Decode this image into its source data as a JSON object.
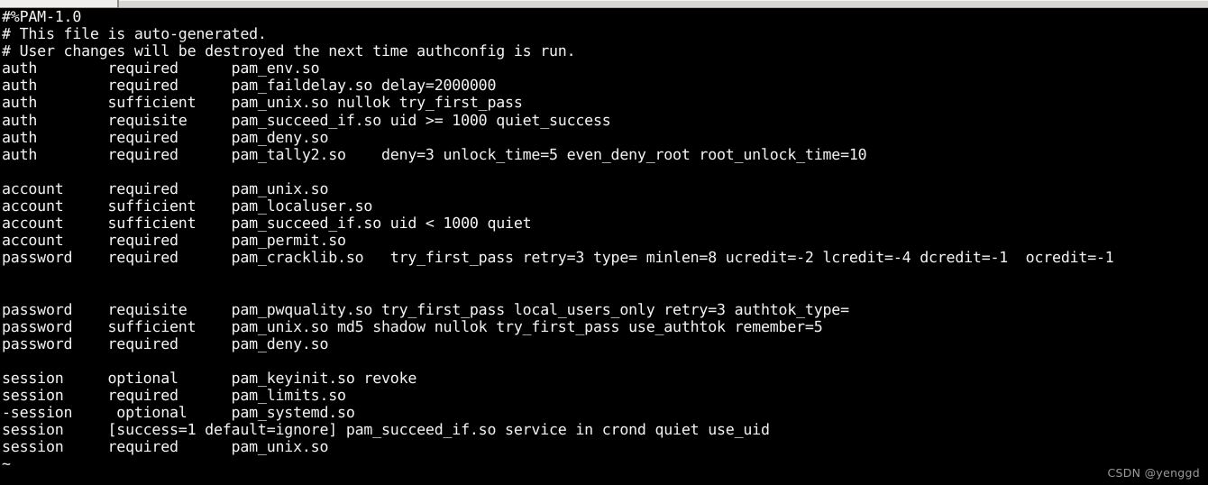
{
  "window": {
    "chrome_present": true,
    "background_color": "#000000",
    "text_color": "#f2f2f2"
  },
  "terminal": {
    "title": "",
    "file": "#%PAM-1.0",
    "lines": [
      "#%PAM-1.0",
      "# This file is auto-generated.",
      "# User changes will be destroyed the next time authconfig is run.",
      "auth        required      pam_env.so",
      "auth        required      pam_faildelay.so delay=2000000",
      "auth        sufficient    pam_unix.so nullok try_first_pass",
      "auth        requisite     pam_succeed_if.so uid >= 1000 quiet_success",
      "auth        required      pam_deny.so",
      "auth        required      pam_tally2.so    deny=3 unlock_time=5 even_deny_root root_unlock_time=10",
      "",
      "account     required      pam_unix.so",
      "account     sufficient    pam_localuser.so",
      "account     sufficient    pam_succeed_if.so uid < 1000 quiet",
      "account     required      pam_permit.so",
      "password    required      pam_cracklib.so   try_first_pass retry=3 type= minlen=8 ucredit=-2 lcredit=-4 dcredit=-1  ocredit=-1",
      "",
      "",
      "password    requisite     pam_pwquality.so try_first_pass local_users_only retry=3 authtok_type=",
      "password    sufficient    pam_unix.so md5 shadow nullok try_first_pass use_authtok remember=5",
      "password    required      pam_deny.so",
      "",
      "session     optional      pam_keyinit.so revoke",
      "session     required      pam_limits.so",
      "-session     optional     pam_systemd.so",
      "session     [success=1 default=ignore] pam_succeed_if.so service in crond quiet use_uid",
      "session     required      pam_unix.so",
      "~"
    ]
  },
  "watermark": {
    "text": "CSDN @yenggd",
    "color": "#9a9a9a"
  }
}
